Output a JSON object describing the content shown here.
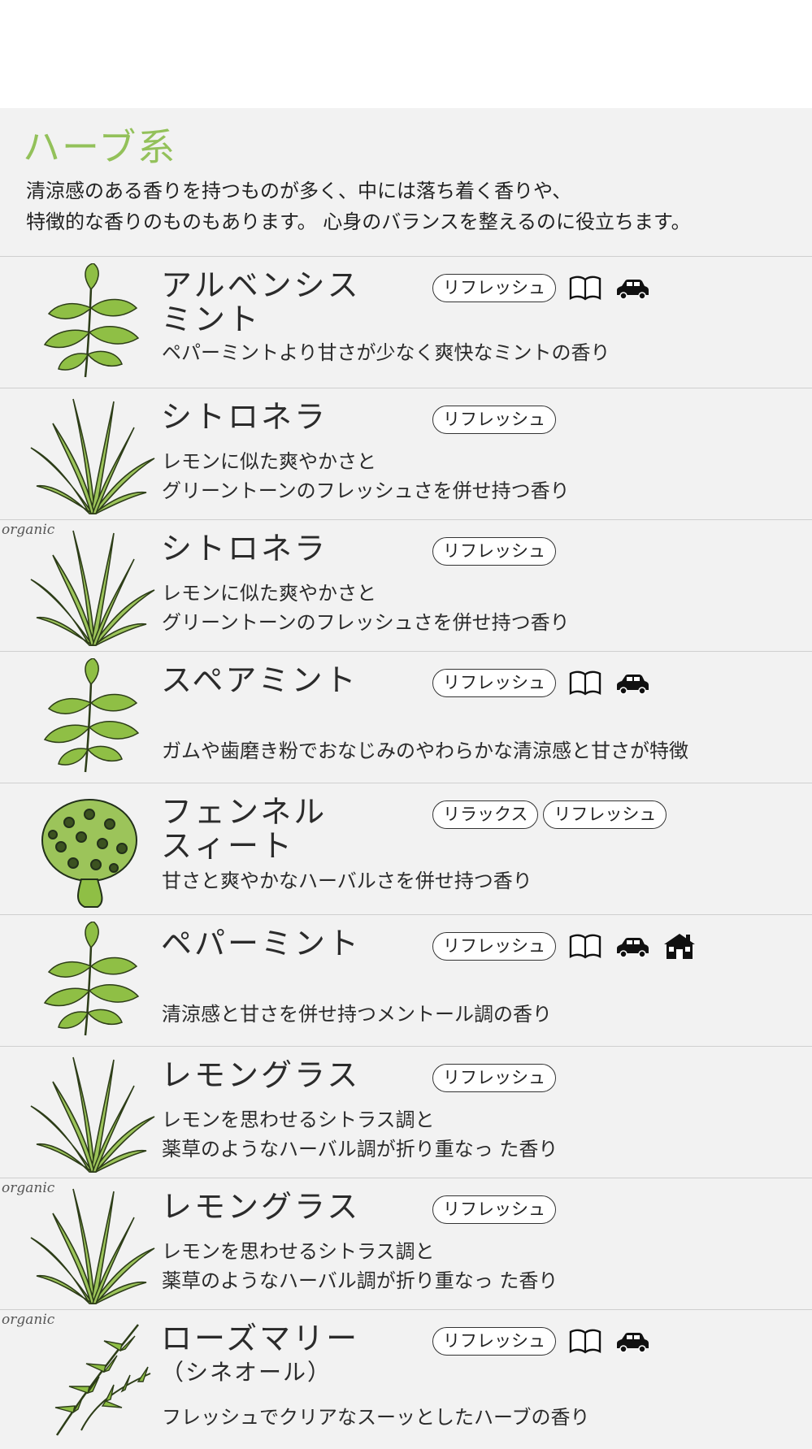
{
  "category": {
    "title": "ハーブ系",
    "description_line1": "清涼感のある香りを持つものが多く、中には落ち着く香りや、",
    "description_line2": "特徴的な香りのものもあります。 心身のバランスを整えるのに役立ちます。"
  },
  "organic_label": "organic",
  "items": [
    {
      "name1": "アルベンシス",
      "name2": "ミント",
      "tags": [
        "リフレッシュ"
      ],
      "icons": [
        "book-icon",
        "car-icon"
      ],
      "desc1": "ペパーミントより甘さが少なく爽快なミントの香り",
      "desc2": ""
    },
    {
      "name1": "シトロネラ",
      "name2": "",
      "tags": [
        "リフレッシュ"
      ],
      "icons": [],
      "desc1": "レモンに似た爽やかさと",
      "desc2": "グリーントーンのフレッシュさを併せ持つ香り"
    },
    {
      "name1": "シトロネラ",
      "name2": "",
      "tags": [
        "リフレッシュ"
      ],
      "icons": [],
      "desc1": "レモンに似た爽やかさと",
      "desc2": "グリーントーンのフレッシュさを併せ持つ香り"
    },
    {
      "name1": "スペアミント",
      "name2": "",
      "tags": [
        "リフレッシュ"
      ],
      "icons": [
        "book-icon",
        "car-icon"
      ],
      "desc1": "ガムや歯磨き粉でおなじみのやわらかな清涼感と甘さが特徴",
      "desc2": ""
    },
    {
      "name1": "フェンネル",
      "name2": "スィート",
      "tags": [
        "リラックス",
        "リフレッシュ"
      ],
      "icons": [],
      "desc1": "甘さと爽やかなハーバルさを併せ持つ香り",
      "desc2": ""
    },
    {
      "name1": "ペパーミント",
      "name2": "",
      "tags": [
        "リフレッシュ"
      ],
      "icons": [
        "book-icon",
        "car-icon",
        "house-icon"
      ],
      "desc1": "清涼感と甘さを併せ持つメントール調の香り",
      "desc2": ""
    },
    {
      "name1": "レモングラス",
      "name2": "",
      "tags": [
        "リフレッシュ"
      ],
      "icons": [],
      "desc1": "レモンを思わせるシトラス調と",
      "desc2": "薬草のようなハーバル調が折り重なっ た香り"
    },
    {
      "name1": "レモングラス",
      "name2": "",
      "tags": [
        "リフレッシュ"
      ],
      "icons": [],
      "desc1": "レモンを思わせるシトラス調と",
      "desc2": "薬草のようなハーバル調が折り重なっ た香り"
    },
    {
      "name1": "ローズマリー",
      "name2": "（シネオール）",
      "tags": [
        "リフレッシュ"
      ],
      "icons": [
        "book-icon",
        "car-icon"
      ],
      "desc1": "フレッシュでクリアなスーッとしたハーブの香り",
      "desc2": ""
    }
  ]
}
